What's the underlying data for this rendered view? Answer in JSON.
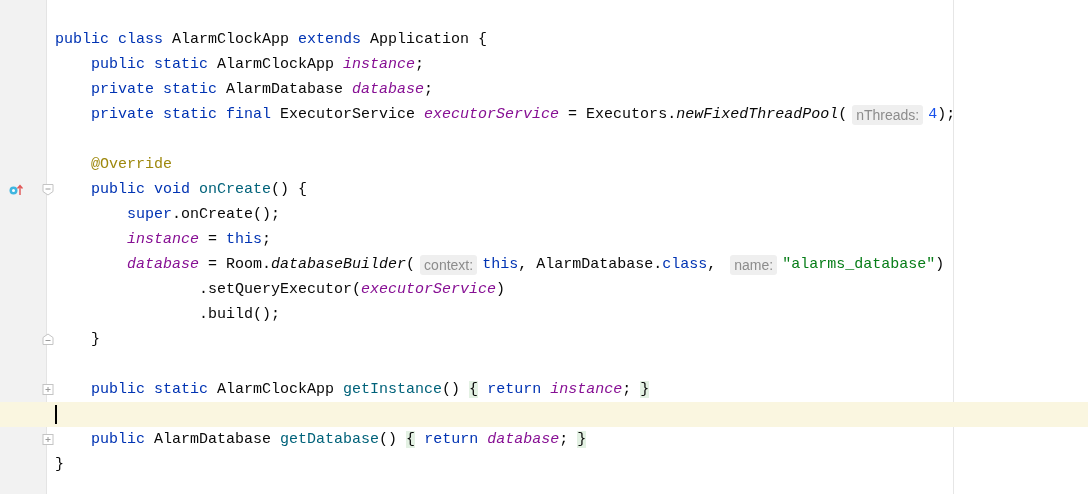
{
  "editor": {
    "lines": [
      {
        "current": false
      },
      {
        "current": false,
        "tokens": [
          {
            "text": "public class ",
            "kind": "keyword"
          },
          {
            "text": "AlarmClockApp ",
            "kind": "plain"
          },
          {
            "text": "extends ",
            "kind": "keyword"
          },
          {
            "text": "Application {",
            "kind": "plain"
          }
        ]
      },
      {
        "current": false,
        "tokens": [
          {
            "text": "    public static ",
            "kind": "keyword"
          },
          {
            "text": "AlarmClockApp ",
            "kind": "plain"
          },
          {
            "text": "instance",
            "kind": "field"
          },
          {
            "text": ";",
            "kind": "plain"
          }
        ]
      },
      {
        "current": false,
        "tokens": [
          {
            "text": "    private static ",
            "kind": "keyword"
          },
          {
            "text": "AlarmDatabase ",
            "kind": "plain"
          },
          {
            "text": "database",
            "kind": "field"
          },
          {
            "text": ";",
            "kind": "plain"
          }
        ]
      },
      {
        "current": false,
        "tokens": [
          {
            "text": "    private static final ",
            "kind": "keyword"
          },
          {
            "text": "ExecutorService ",
            "kind": "plain"
          },
          {
            "text": "executorService",
            "kind": "field"
          },
          {
            "text": " = Executors.",
            "kind": "plain"
          },
          {
            "text": "newFixedThreadPool",
            "kind": "call"
          },
          {
            "text": "(",
            "kind": "plain"
          },
          {
            "text": "nThreads:",
            "kind": "hint"
          },
          {
            "text": "4",
            "kind": "number"
          },
          {
            "text": ");",
            "kind": "plain"
          }
        ]
      },
      {
        "current": false
      },
      {
        "current": false,
        "tokens": [
          {
            "text": "    @Override",
            "kind": "annotation"
          }
        ]
      },
      {
        "current": false,
        "icons": [
          {
            "kind": "override"
          },
          {
            "kind": "fold-start"
          }
        ],
        "tokens": [
          {
            "text": "    public void ",
            "kind": "keyword"
          },
          {
            "text": "onCreate",
            "kind": "method"
          },
          {
            "text": "() {",
            "kind": "plain"
          }
        ]
      },
      {
        "current": false,
        "tokens": [
          {
            "text": "        super",
            "kind": "keyword"
          },
          {
            "text": ".onCreate();",
            "kind": "plain"
          }
        ]
      },
      {
        "current": false,
        "tokens": [
          {
            "text": "        instance",
            "kind": "field"
          },
          {
            "text": " = ",
            "kind": "plain"
          },
          {
            "text": "this",
            "kind": "keyword"
          },
          {
            "text": ";",
            "kind": "plain"
          }
        ]
      },
      {
        "current": false,
        "tokens": [
          {
            "text": "        database",
            "kind": "field"
          },
          {
            "text": " = Room.",
            "kind": "plain"
          },
          {
            "text": "databaseBuilder",
            "kind": "call"
          },
          {
            "text": "(",
            "kind": "plain"
          },
          {
            "text": "context:",
            "kind": "hint"
          },
          {
            "text": "this",
            "kind": "keyword"
          },
          {
            "text": ", AlarmDatabase.",
            "kind": "plain"
          },
          {
            "text": "class",
            "kind": "keyword"
          },
          {
            "text": ", ",
            "kind": "plain"
          },
          {
            "text": "name:",
            "kind": "hint"
          },
          {
            "text": "\"alarms_database\"",
            "kind": "string"
          },
          {
            "text": ")",
            "kind": "plain"
          }
        ]
      },
      {
        "current": false,
        "tokens": [
          {
            "text": "                .setQueryExecutor(",
            "kind": "plain"
          },
          {
            "text": "executorService",
            "kind": "field"
          },
          {
            "text": ")",
            "kind": "plain"
          }
        ]
      },
      {
        "current": false,
        "tokens": [
          {
            "text": "                .build();",
            "kind": "plain"
          }
        ]
      },
      {
        "current": false,
        "icons": [
          {
            "kind": "fold-end"
          }
        ],
        "tokens": [
          {
            "text": "    }",
            "kind": "plain"
          }
        ]
      },
      {
        "current": false
      },
      {
        "current": false,
        "icons": [
          {
            "kind": "fold-collapsed"
          }
        ],
        "tokens": [
          {
            "text": "    public static ",
            "kind": "keyword"
          },
          {
            "text": "AlarmClockApp ",
            "kind": "plain"
          },
          {
            "text": "getInstance",
            "kind": "method"
          },
          {
            "text": "() ",
            "kind": "plain"
          },
          {
            "text": "{",
            "kind": "fold-brace"
          },
          {
            "text": " return ",
            "kind": "keyword"
          },
          {
            "text": "instance",
            "kind": "field"
          },
          {
            "text": "; ",
            "kind": "plain"
          },
          {
            "text": "}",
            "kind": "fold-brace"
          }
        ]
      },
      {
        "current": true
      },
      {
        "current": false,
        "icons": [
          {
            "kind": "fold-collapsed"
          }
        ],
        "tokens": [
          {
            "text": "    public ",
            "kind": "keyword"
          },
          {
            "text": "AlarmDatabase ",
            "kind": "plain"
          },
          {
            "text": "getDatabase",
            "kind": "method"
          },
          {
            "text": "() ",
            "kind": "plain"
          },
          {
            "text": "{",
            "kind": "fold-brace"
          },
          {
            "text": " return ",
            "kind": "keyword"
          },
          {
            "text": "database",
            "kind": "field"
          },
          {
            "text": "; ",
            "kind": "plain"
          },
          {
            "text": "}",
            "kind": "fold-brace"
          }
        ]
      },
      {
        "current": false,
        "tokens": [
          {
            "text": "}",
            "kind": "plain"
          }
        ]
      }
    ]
  }
}
